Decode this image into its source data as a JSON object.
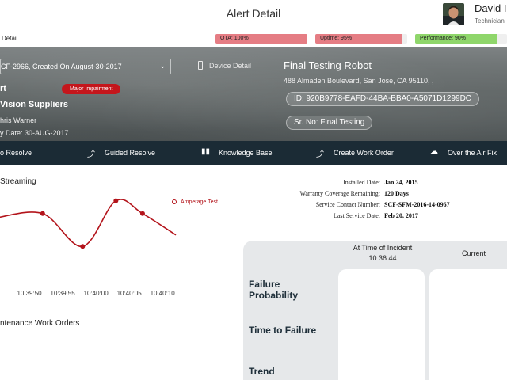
{
  "header": {
    "title": "Alert Detail",
    "user_name": "David I",
    "user_role": "Technician"
  },
  "kpis": {
    "detail_link": "Detail",
    "items": [
      {
        "label": "OTA: 100%",
        "value": 100,
        "color": "#e57d84"
      },
      {
        "label": "Uptime: 95%",
        "value": 95,
        "color": "#e57d84"
      },
      {
        "label": "Performance: 90%",
        "value": 90,
        "color": "#8fd66b"
      }
    ]
  },
  "alert": {
    "case_selector": "CF-2966, Created On August-30-2017",
    "device_detail": "Device Detail",
    "name": "rt",
    "severity_badge": "Major Impairment",
    "supplier": "Vision Suppliers",
    "person": "hris Warner",
    "due_date": "y Date: 30-AUG-2017"
  },
  "device": {
    "name": "Final Testing Robot",
    "address": "488 Almaden Boulevard, San Jose, CA 95110, ,",
    "id": "ID: 920B9778-EAFD-44BA-BBA0-A5071D1299DC",
    "serial": "Sr. No: Final Testing"
  },
  "actions": {
    "resolve": "o Resolve",
    "guided": "Guided Resolve",
    "kb": "Knowledge Base",
    "work_order": "Create Work Order",
    "ota": "Over the Air Fix"
  },
  "stream": {
    "title": "Streaming",
    "legend": "Amperage Test",
    "maintenance_title": "ntenance Work Orders"
  },
  "chart_data": {
    "type": "line",
    "categories": [
      "10:39:50",
      "10:39:55",
      "10:40:00",
      "10:40:05",
      "10:40:10"
    ],
    "series": [
      {
        "name": "Amperage Test",
        "color": "#b3141b",
        "points": [
          {
            "x": "10:39:45",
            "y": 3.6
          },
          {
            "x": "10:39:52",
            "y": 3.9
          },
          {
            "x": "10:39:58",
            "y": 1.6
          },
          {
            "x": "10:40:03",
            "y": 4.8
          },
          {
            "x": "10:40:07",
            "y": 3.9
          },
          {
            "x": "10:40:12",
            "y": 2.4
          }
        ],
        "markers": [
          "10:39:52",
          "10:39:58",
          "10:40:03",
          "10:40:07"
        ]
      }
    ],
    "legend_position": "top-right",
    "grid": false
  },
  "details": {
    "rows": [
      {
        "label": "Installed Date:",
        "value": "Jan 24, 2015"
      },
      {
        "label": "Warranty Coverage Remaining:",
        "value": "120 Days"
      },
      {
        "label": "Service Contact Number:",
        "value": "SCF-SFM-2016-14-0967"
      },
      {
        "label": "Last Service Date:",
        "value": "Feb 20, 2017"
      }
    ]
  },
  "incident": {
    "col_time_label": "At Time of Incident",
    "col_time_value": "10:36:44",
    "col_current": "Current",
    "metrics": [
      "Failure Probability",
      "Time to Failure",
      "Trend"
    ]
  }
}
